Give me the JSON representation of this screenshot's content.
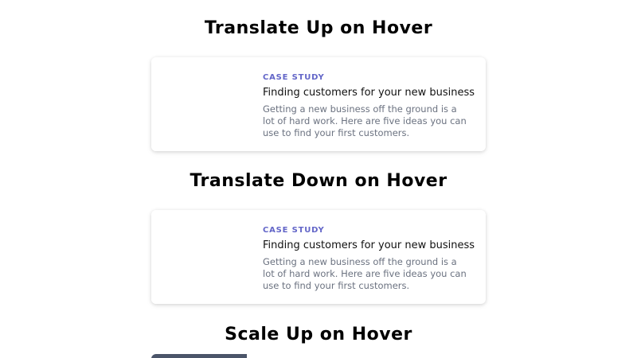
{
  "sections": [
    {
      "title": "Translate Up on Hover",
      "card": {
        "category": "Case Study",
        "title": "Finding customers for your new business",
        "description": "Getting a new business off the ground is a lot of hard work. Here are five ideas you can use to find your first customers."
      }
    },
    {
      "title": "Translate Down on Hover",
      "card": {
        "category": "Case Study",
        "title": "Finding customers for your new business",
        "description": "Getting a new business off the ground is a lot of hard work. Here are five ideas you can use to find your first customers."
      }
    },
    {
      "title": "Scale Up on Hover"
    }
  ],
  "colors": {
    "category_accent": "#6366c8",
    "description_gray": "#6b7280",
    "partial_image": "#4b5569"
  }
}
